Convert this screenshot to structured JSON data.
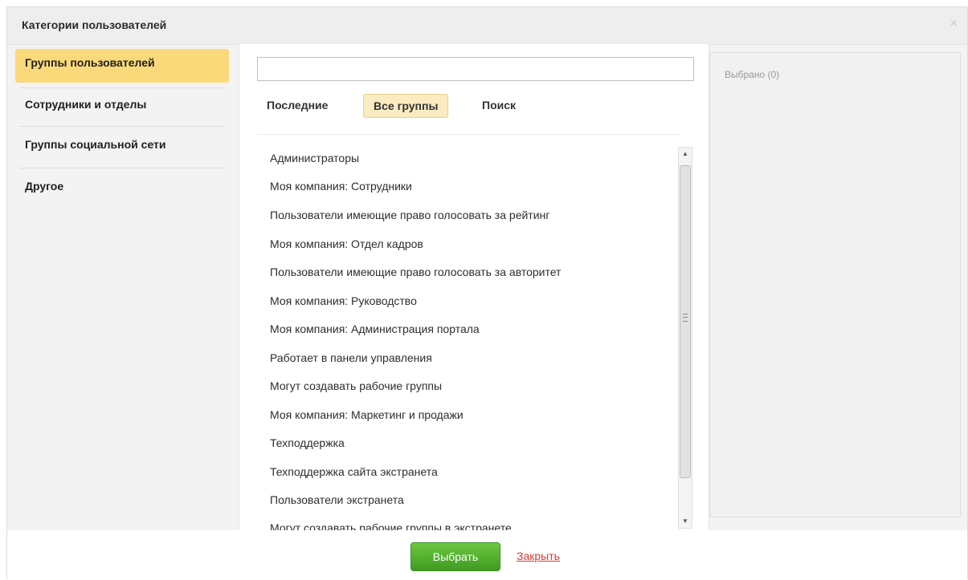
{
  "dialog": {
    "title": "Категории пользователей",
    "close_symbol": "×"
  },
  "sidebar": {
    "items": [
      {
        "label": "Группы пользователей",
        "active": true
      },
      {
        "label": "Сотрудники и отделы",
        "active": false
      },
      {
        "label": "Группы социальной сети",
        "active": false
      },
      {
        "label": "Другое",
        "active": false
      }
    ]
  },
  "search": {
    "value": "",
    "placeholder": ""
  },
  "tabs": [
    {
      "label": "Последние",
      "active": false
    },
    {
      "label": "Все группы",
      "active": true
    },
    {
      "label": "Поиск",
      "active": false
    }
  ],
  "groups": [
    "Администраторы",
    "Моя компания: Сотрудники",
    "Пользователи имеющие право голосовать за рейтинг",
    "Моя компания: Отдел кадров",
    "Пользователи имеющие право голосовать за авторитет",
    "Моя компания: Руководство",
    "Моя компания: Администрация портала",
    "Работает в панели управления",
    "Могут создавать рабочие группы",
    "Моя компания: Маркетинг и продажи",
    "Техподдержка",
    "Техподдержка сайта экстранета",
    "Пользователи экстранета",
    "Могут создавать рабочие группы в экстранете"
  ],
  "selected_panel": {
    "label": "Выбрано (0)"
  },
  "footer": {
    "select_label": "Выбрать",
    "close_label": "Закрыть"
  },
  "colors": {
    "active_sidebar": "#fad97b",
    "active_tab": "#faebc0",
    "select_button": "#46a62c",
    "close_link": "#d63a3a"
  },
  "icons": {
    "close": "close-icon",
    "scroll_up": "arrow-up-icon",
    "scroll_down": "arrow-down-icon"
  }
}
